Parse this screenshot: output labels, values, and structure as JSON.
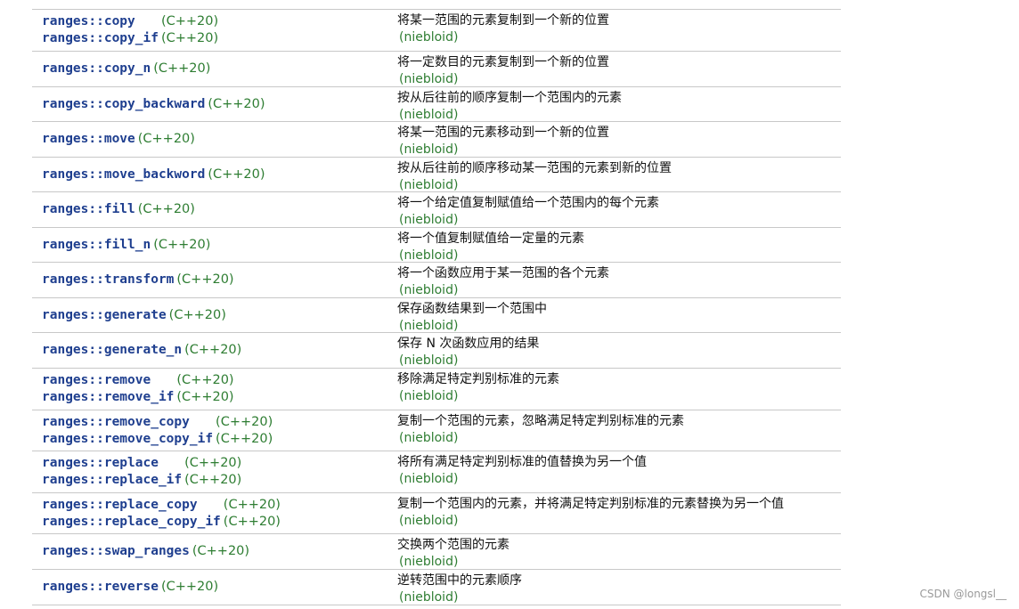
{
  "rows": [
    {
      "fns": [
        {
          "name": "ranges::copy",
          "ver": "(C++20)"
        },
        {
          "name": "ranges::copy_if",
          "ver": "(C++20)"
        }
      ],
      "desc": "将某一范围的元素复制到一个新的位置",
      "tag": "(niebloid)"
    },
    {
      "fns": [
        {
          "name": "ranges::copy_n",
          "ver": "(C++20)"
        }
      ],
      "desc": "将一定数目的元素复制到一个新的位置",
      "tag": "(niebloid)"
    },
    {
      "fns": [
        {
          "name": "ranges::copy_backward",
          "ver": "(C++20)"
        }
      ],
      "desc": "按从后往前的顺序复制一个范围内的元素",
      "tag": "(niebloid)"
    },
    {
      "fns": [
        {
          "name": "ranges::move",
          "ver": "(C++20)"
        }
      ],
      "desc": "将某一范围的元素移动到一个新的位置",
      "tag": "(niebloid)"
    },
    {
      "fns": [
        {
          "name": "ranges::move_backword",
          "ver": "(C++20)"
        }
      ],
      "desc": "按从后往前的顺序移动某一范围的元素到新的位置",
      "tag": "(niebloid)"
    },
    {
      "fns": [
        {
          "name": "ranges::fill",
          "ver": "(C++20)"
        }
      ],
      "desc": "将一个给定值复制赋值给一个范围内的每个元素",
      "tag": "(niebloid)"
    },
    {
      "fns": [
        {
          "name": "ranges::fill_n",
          "ver": "(C++20)"
        }
      ],
      "desc": "将一个值复制赋值给一定量的元素",
      "tag": "(niebloid)"
    },
    {
      "fns": [
        {
          "name": "ranges::transform",
          "ver": "(C++20)"
        }
      ],
      "desc": "将一个函数应用于某一范围的各个元素",
      "tag": "(niebloid)"
    },
    {
      "fns": [
        {
          "name": "ranges::generate",
          "ver": "(C++20)"
        }
      ],
      "desc": "保存函数结果到一个范围中",
      "tag": "(niebloid)"
    },
    {
      "fns": [
        {
          "name": "ranges::generate_n",
          "ver": "(C++20)"
        }
      ],
      "desc": "保存 N 次函数应用的结果",
      "tag": "(niebloid)"
    },
    {
      "fns": [
        {
          "name": "ranges::remove",
          "ver": "(C++20)"
        },
        {
          "name": "ranges::remove_if",
          "ver": "(C++20)"
        }
      ],
      "desc": "移除满足特定判别标准的元素",
      "tag": "(niebloid)"
    },
    {
      "fns": [
        {
          "name": "ranges::remove_copy",
          "ver": "(C++20)"
        },
        {
          "name": "ranges::remove_copy_if",
          "ver": "(C++20)"
        }
      ],
      "desc": "复制一个范围的元素，忽略满足特定判别标准的元素",
      "tag": "(niebloid)"
    },
    {
      "fns": [
        {
          "name": "ranges::replace",
          "ver": "(C++20)"
        },
        {
          "name": "ranges::replace_if",
          "ver": "(C++20)"
        }
      ],
      "desc": "将所有满足特定判别标准的值替换为另一个值",
      "tag": "(niebloid)"
    },
    {
      "fns": [
        {
          "name": "ranges::replace_copy",
          "ver": "(C++20)"
        },
        {
          "name": "ranges::replace_copy_if",
          "ver": "(C++20)"
        }
      ],
      "desc": "复制一个范围内的元素，并将满足特定判别标准的元素替换为另一个值",
      "tag": "(niebloid)"
    },
    {
      "fns": [
        {
          "name": "ranges::swap_ranges",
          "ver": "(C++20)"
        }
      ],
      "desc": "交换两个范围的元素",
      "tag": "(niebloid)"
    },
    {
      "fns": [
        {
          "name": "ranges::reverse",
          "ver": "(C++20)"
        }
      ],
      "desc": "逆转范围中的元素顺序",
      "tag": "(niebloid)"
    }
  ],
  "watermark": "CSDN @longsl__"
}
